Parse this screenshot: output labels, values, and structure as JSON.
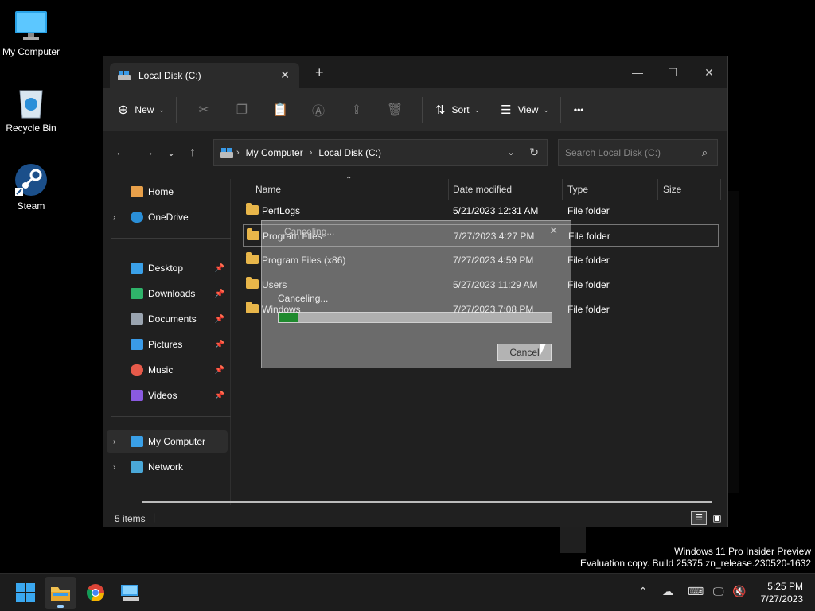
{
  "desktop": {
    "icons": [
      {
        "label": "My Computer"
      },
      {
        "label": "Recycle Bin"
      },
      {
        "label": "Steam"
      }
    ]
  },
  "window": {
    "tab_title": "Local Disk (C:)",
    "toolbar": {
      "new_label": "New",
      "sort_label": "Sort",
      "view_label": "View",
      "more_label": "•••"
    },
    "address": {
      "crumbs": [
        "My Computer",
        "Local Disk (C:)"
      ],
      "search_placeholder": "Search Local Disk (C:)"
    },
    "sidebar": {
      "home": "Home",
      "onedrive": "OneDrive",
      "pinned": [
        "Desktop",
        "Downloads",
        "Documents",
        "Pictures",
        "Music",
        "Videos"
      ],
      "my_computer": "My Computer",
      "network": "Network"
    },
    "columns": [
      "Name",
      "Date modified",
      "Type",
      "Size"
    ],
    "rows": [
      {
        "name": "PerfLogs",
        "date": "5/21/2023 12:31 AM",
        "type": "File folder"
      },
      {
        "name": "Program Files",
        "date": "7/27/2023 4:27 PM",
        "type": "File folder"
      },
      {
        "name": "Program Files (x86)",
        "date": "7/27/2023 4:59 PM",
        "type": "File folder"
      },
      {
        "name": "Users",
        "date": "5/27/2023 11:29 AM",
        "type": "File folder"
      },
      {
        "name": "Windows",
        "date": "7/27/2023 7:08 PM",
        "type": "File folder"
      }
    ],
    "status": "5 items"
  },
  "dialog": {
    "title": "Canceling...",
    "status": "Canceling...",
    "progress": 0.07,
    "cancel_label": "Cancel"
  },
  "watermark": {
    "line1": "Windows 11 Pro Insider Preview",
    "line2": "Evaluation copy. Build 25375.zn_release.230520-1632"
  },
  "clock": {
    "time": "5:25 PM",
    "date": "7/27/2023"
  },
  "colors": {
    "accent": "#60cdff",
    "folder": "#e8b64a",
    "progress": "#1f8a2e"
  }
}
